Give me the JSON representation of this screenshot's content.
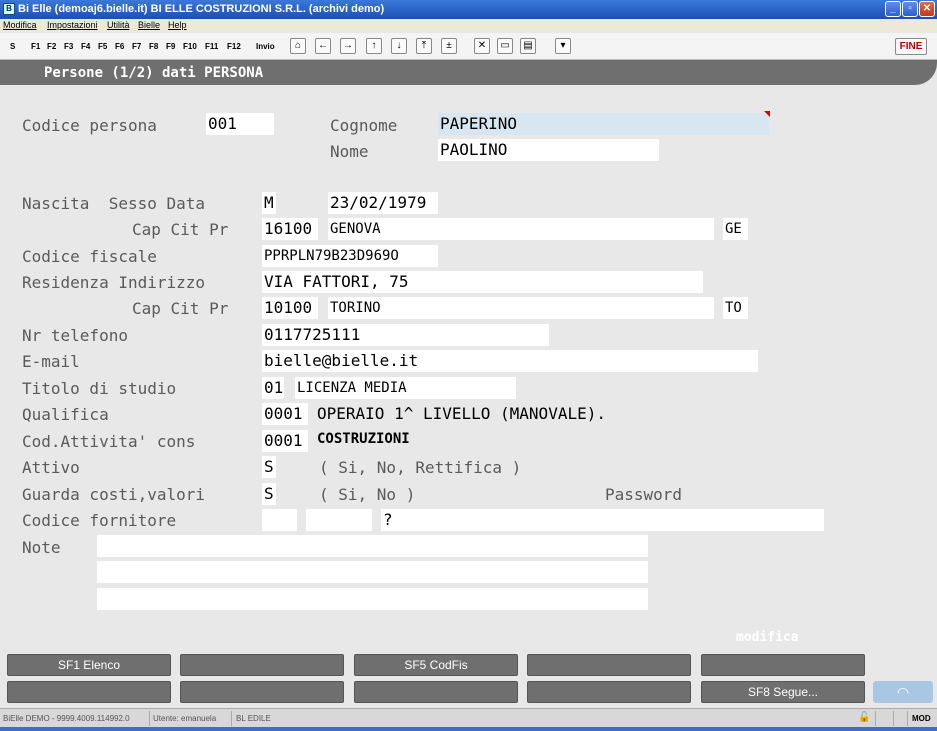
{
  "window": {
    "title": "Bi Elle (demoaj6.bielle.it)   BI ELLE COSTRUZIONI S.R.L. (archivi demo)",
    "app_icon": "B"
  },
  "menu": [
    "Modifica",
    "Impostazioni",
    "Utilità",
    "Bielle",
    "Help"
  ],
  "toolbar": {
    "keys": [
      "S",
      "F1",
      "F2",
      "F3",
      "F4",
      "F5",
      "F6",
      "F7",
      "F8",
      "F9",
      "F10",
      "F11",
      "F12",
      "Invio"
    ],
    "icons": [
      "home-icon",
      "arrow-left-icon",
      "arrow-right-icon",
      "arrow-up-icon",
      "arrow-down-icon",
      "first-record-icon",
      "plus-minus-icon",
      "delete-icon",
      "copy-icon",
      "paste-icon",
      "filter-icon"
    ],
    "fine_label": "FINE"
  },
  "page_title": "Persone (1/2) dati PERSONA",
  "labels": {
    "codice_persona": "Codice persona",
    "cognome": "Cognome",
    "nome": "Nome",
    "nascita": "Nascita  Sesso Data",
    "nascita_cap": "Cap Cit Pr",
    "codice_fiscale": "Codice fiscale",
    "residenza": "Residenza Indirizzo",
    "residenza_cap": "Cap Cit Pr",
    "telefono": "Nr telefono",
    "email": "E-mail",
    "titolo_studio": "Titolo di studio",
    "qualifica": "Qualifica",
    "cod_attivita": "Cod.Attivita' cons",
    "attivo": "Attivo",
    "attivo_hint": "( Si, No, Rettifica )",
    "guarda_costi": "Guarda costi,valori",
    "guarda_hint": "( Si, No )",
    "password": "Password",
    "codice_fornitore": "Codice fornitore",
    "note": "Note"
  },
  "fields": {
    "codice_persona": "001",
    "cognome": "PAPERINO",
    "nome": "PAOLINO",
    "sesso": "M",
    "data_nascita": "23/02/1979",
    "nascita_cap": "16100",
    "nascita_citta": "GENOVA",
    "nascita_pr": "GE",
    "codice_fiscale": "PPRPLN79B23D969O",
    "indirizzo": "VIA FATTORI, 75",
    "residenza_cap": "10100",
    "residenza_citta": "TORINO",
    "residenza_pr": "TO",
    "telefono": "0117725111",
    "email": "bielle@bielle.it",
    "titolo_codice": "01",
    "titolo_descr": "LICENZA MEDIA",
    "qualifica_codice": "0001",
    "qualifica_descr": "OPERAIO 1^ LIVELLO (MANOVALE).",
    "attivita_codice": "0001",
    "attivita_descr": "COSTRUZIONI",
    "attivo": "S",
    "guarda_costi": "S",
    "fornitore_1": "",
    "fornitore_2": "",
    "fornitore_3": "?",
    "note_1": "",
    "note_2": "",
    "note_3": ""
  },
  "mode_label": "modifica",
  "function_buttons": {
    "row1": [
      "SF1  Elenco",
      "",
      "SF5  CodFis",
      "",
      ""
    ],
    "row2": [
      "",
      "",
      "",
      "",
      "SF8  Segue..."
    ]
  },
  "status": {
    "version": "BiElle DEMO - 9999.4009.114992.0",
    "user": "Utente: emanuela",
    "module": "BL EDILE",
    "mode": "MOD"
  }
}
